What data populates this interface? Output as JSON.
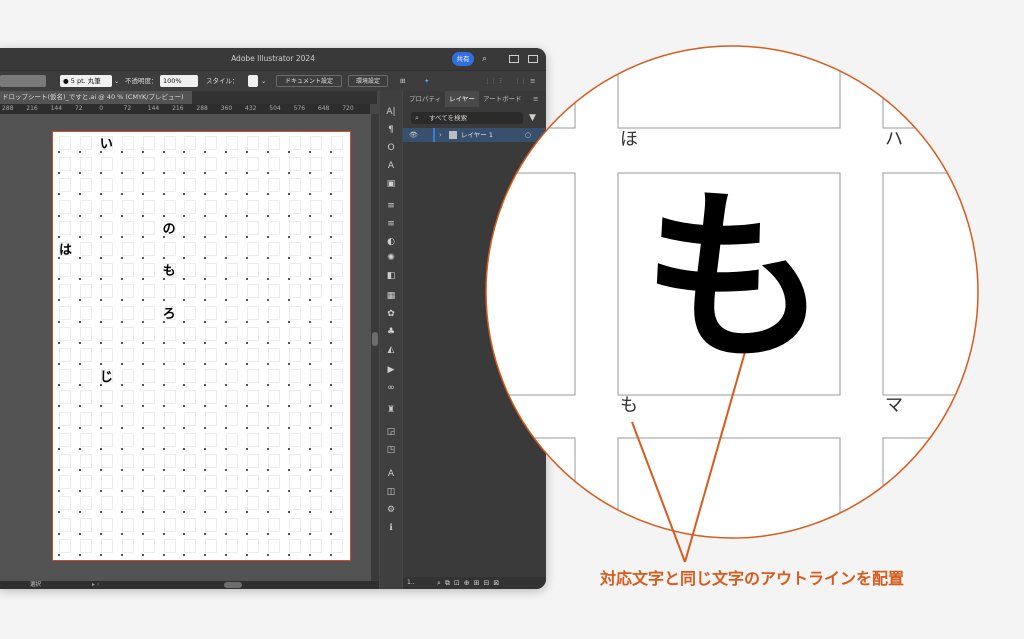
{
  "app": {
    "title": "Adobe Illustrator 2024",
    "share_label": "共有"
  },
  "controlbar": {
    "stroke_label": "● 5 pt. 丸筆",
    "opacity_label": "不透明度：",
    "opacity_value": "100%",
    "style_label": "スタイル：",
    "document_setup_label": "ドキュメント設定",
    "preferences_label": "環境設定"
  },
  "document": {
    "tab_title": "ドロップシート(仮名)_ですと.ai @ 40 % (CMYK/プレビュー)"
  },
  "ruler": [
    "288",
    "216",
    "144",
    "72",
    "0",
    "72",
    "144",
    "216",
    "288",
    "360",
    "432",
    "504",
    "576",
    "648",
    "720"
  ],
  "artboard_glyphs": [
    "い",
    "の",
    "は",
    "も",
    "ろ",
    "じ"
  ],
  "status": {
    "mode_label": "選択",
    "left_text": "1.."
  },
  "panel": {
    "tabs": [
      "プロパティ",
      "レイヤー",
      "アートボード"
    ],
    "search_placeholder": "すべてを検索",
    "layer_name": "レイヤー 1"
  },
  "zoom": {
    "labels": [
      "ほ",
      "ハ",
      "も",
      "マ"
    ],
    "big_glyph": "も",
    "caption": "対応文字と同じ文字のアウトラインを配置",
    "accent_color": "#d85b1b"
  }
}
